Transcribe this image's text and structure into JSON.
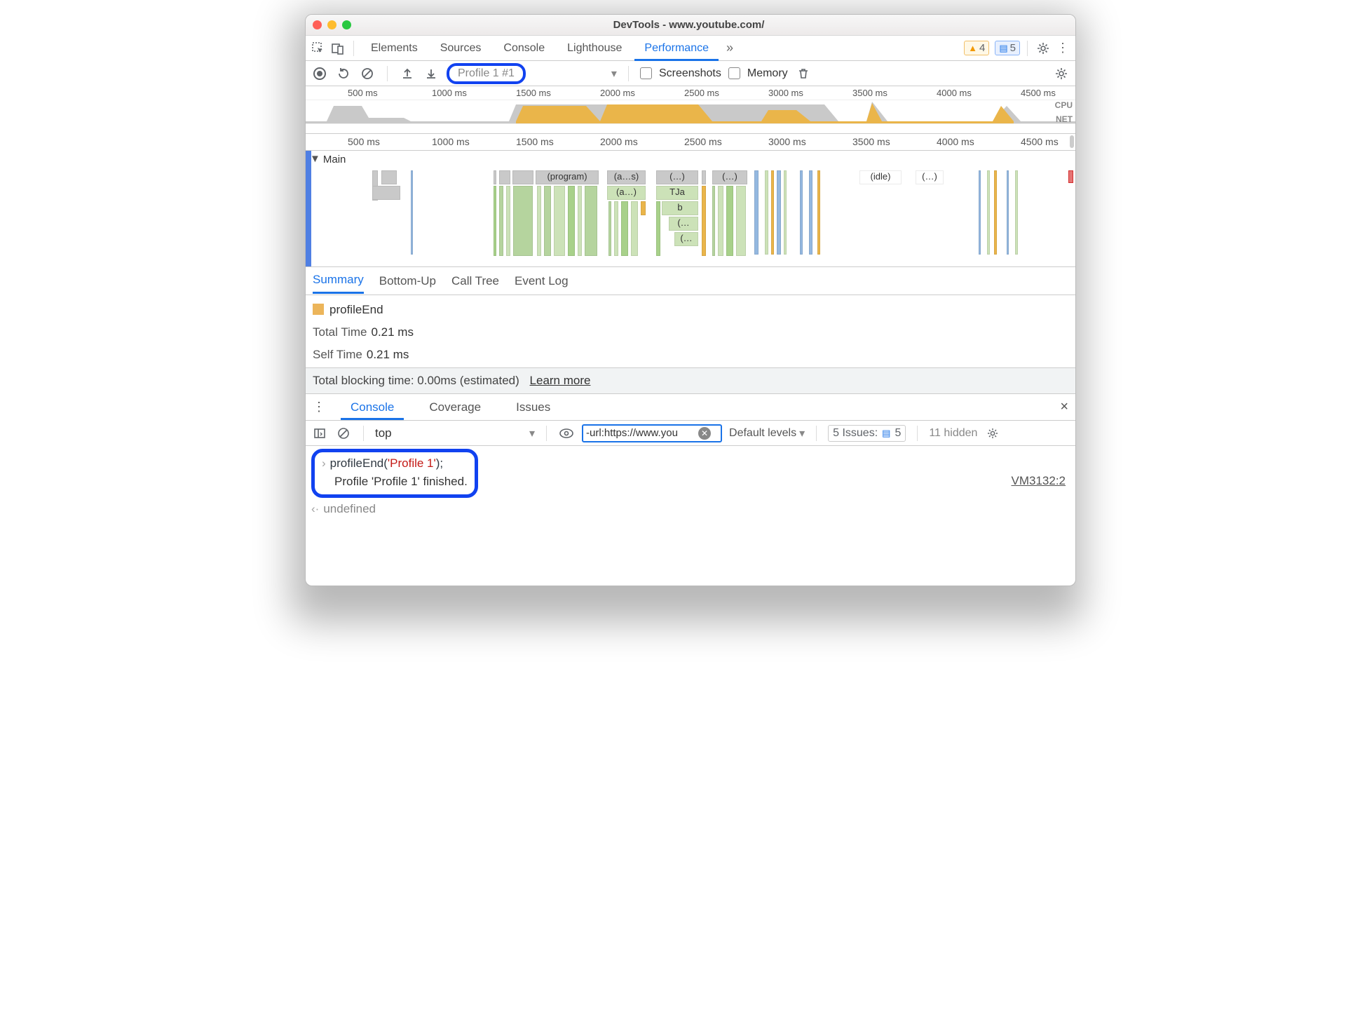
{
  "window": {
    "title": "DevTools - www.youtube.com/"
  },
  "tabs": {
    "elements": "Elements",
    "sources": "Sources",
    "console": "Console",
    "lighthouse": "Lighthouse",
    "performance": "Performance"
  },
  "warnings": {
    "count": "4"
  },
  "messages": {
    "count": "5"
  },
  "profile": {
    "label": "Profile 1 #1"
  },
  "toolbar": {
    "screenshots": "Screenshots",
    "memory": "Memory"
  },
  "ruler": {
    "t1": "500 ms",
    "t2": "1000 ms",
    "t3": "1500 ms",
    "t4": "2000 ms",
    "t5": "2500 ms",
    "t6": "3000 ms",
    "t7": "3500 ms",
    "t8": "4000 ms",
    "t9": "4500 ms"
  },
  "ovlabels": {
    "cpu": "CPU",
    "net": "NET"
  },
  "flame": {
    "main": "Main",
    "program": "(program)",
    "as": "(a…s)",
    "dots1": "(…)",
    "dots2": "(…)",
    "idle": "(idle)",
    "dots3": "(…)",
    "a2": "(a…)",
    "tja": "TJa",
    "b": "b",
    "d4": "(…",
    "d5": "(…"
  },
  "subtabs": {
    "summary": "Summary",
    "bottomup": "Bottom-Up",
    "calltree": "Call Tree",
    "eventlog": "Event Log"
  },
  "summary": {
    "name": "profileEnd",
    "totallabel": "Total Time",
    "totalval": "0.21 ms",
    "selflabel": "Self Time",
    "selfval": "0.21 ms"
  },
  "tbt": {
    "text": "Total blocking time: 0.00ms (estimated)",
    "link": "Learn more"
  },
  "drawer": {
    "console": "Console",
    "coverage": "Coverage",
    "issues": "Issues"
  },
  "drawertb": {
    "context": "top",
    "filter": "-url:https://www.you",
    "levels": "Default levels",
    "issueslabel": "5 Issues:",
    "issuescount": "5",
    "hidden": "11 hidden"
  },
  "consolebox": {
    "cmd_pre": "profileEnd(",
    "cmd_str": "'Profile 1'",
    "cmd_post": ");",
    "out": "Profile 'Profile 1' finished.",
    "vmlink": "VM3132:2",
    "undef": "undefined"
  }
}
